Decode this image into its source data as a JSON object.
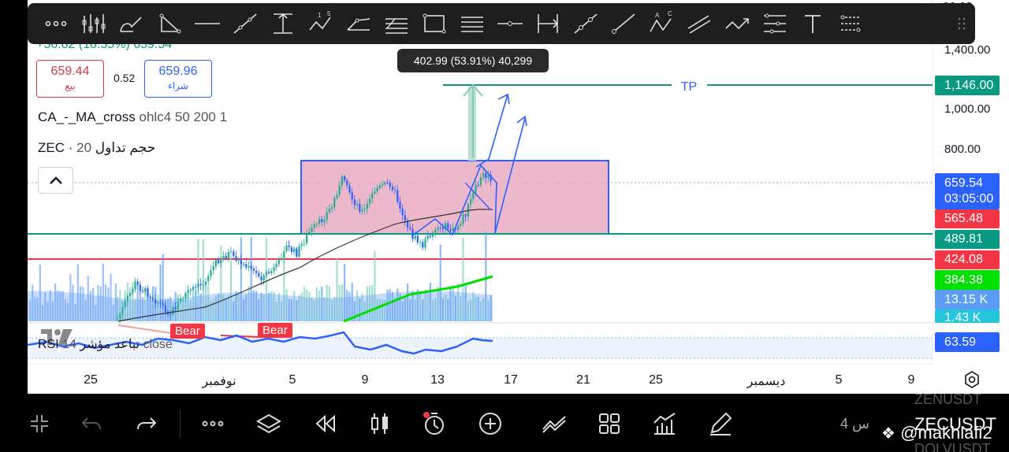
{
  "toolbar": {
    "tools": [
      "more-icon",
      "fib-icon",
      "brush-icon",
      "triangle-icon",
      "horizontal-line-icon",
      "trend-line-icon",
      "vertical-range-icon",
      "abcd-pattern-icon",
      "path-icon",
      "parallel-channel-icon",
      "rectangle-icon",
      "fib-levels-icon",
      "horizontal-ray-icon",
      "date-price-range-icon",
      "extended-line-icon",
      "ray-icon",
      "xabcd-pattern-icon",
      "parallel-lines-icon",
      "polyline-icon",
      "measure-icon",
      "text-icon",
      "regression-icon"
    ]
  },
  "quote": {
    "partial_change": "+56.82 (18.55%) 659.54",
    "sell_price": "659.44",
    "sell_label": "بيع",
    "spread": "0.52",
    "buy_price": "659.96",
    "buy_label": "شراء"
  },
  "indicators": {
    "ma_name": "CA_-_MA_cross",
    "ma_params": "ohlc4 50 200 1",
    "vol_name": "ZEC · حجم تداول",
    "vol_params": "20",
    "rsi_name": "RSI تباعد مؤشر",
    "rsi_params": "14 close"
  },
  "measure_tooltip": "402.99 (53.91%) 40,299",
  "tp_label": "TP",
  "bear_labels": [
    "Bear",
    "Bear"
  ],
  "price_axis": {
    "ticks": [
      "1,400.00",
      "1,000.00",
      "800.00"
    ],
    "top_partial": "00.00"
  },
  "price_tags": [
    {
      "label": "1,146.00",
      "color": "#089981"
    },
    {
      "label": "659.54",
      "sub": "03:05:00",
      "color": "#2962ff"
    },
    {
      "label": "565.48",
      "color": "#f23645"
    },
    {
      "label": "489.81",
      "color": "#089981"
    },
    {
      "label": "424.08",
      "color": "#f23645"
    },
    {
      "label": "384.38",
      "color": "#00e000"
    },
    {
      "label": "13.15 K",
      "color": "#5b9cf6"
    },
    {
      "label": "1.43 K",
      "color": "#26c6da"
    },
    {
      "label": "63.59",
      "color": "#2962ff"
    }
  ],
  "time_axis": [
    "25",
    "نوفمبر",
    "5",
    "9",
    "13",
    "17",
    "21",
    "25",
    "ديسمبر",
    "5",
    "9"
  ],
  "bottom_bar": {
    "tools": [
      "fullscreen-icon",
      "undo-icon",
      "redo-icon",
      "more-icon",
      "layers-icon",
      "replay-icon",
      "candle-type-icon",
      "alert-clock-icon",
      "add-icon",
      "compare-icon",
      "layout-icon",
      "indicators-icon",
      "drawing-icon"
    ],
    "interval": "4 س",
    "symbol_ghost_top": "ZENUSDT",
    "symbol": "ZECUSDT",
    "symbol_ghost_bottom": "DOLVUSDT",
    "watermark": "@makhlafi2"
  },
  "colors": {
    "up": "#22ab94",
    "down": "#2962ff",
    "box_fill": "#e8a6bf",
    "box_border": "#2962ff",
    "tp_line": "#089981",
    "support_line": "#089981",
    "resistance_line": "#f23645",
    "volume": "#5b9cf6",
    "ma_fast": "#00e000"
  }
}
